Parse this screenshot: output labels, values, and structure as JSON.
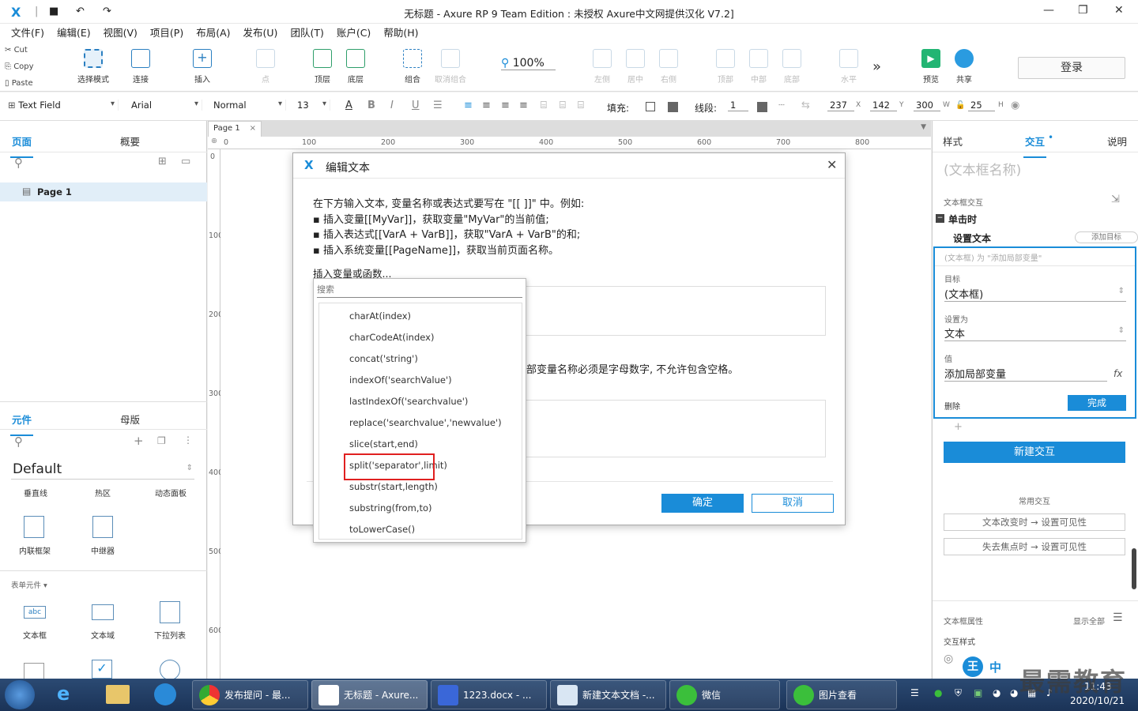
{
  "titlebar": {
    "logo": "X",
    "title": "无标题 - Axure RP 9 Team Edition : 未授权      Axure中文网提供汉化 V7.2]",
    "min": "—",
    "max": "❐",
    "close": "✕"
  },
  "menu": [
    "文件(F)",
    "编辑(E)",
    "视图(V)",
    "项目(P)",
    "布局(A)",
    "发布(U)",
    "团队(T)",
    "账户(C)",
    "帮助(H)"
  ],
  "clipboard": {
    "cut": "Cut",
    "copy": "Copy",
    "paste": "Paste"
  },
  "toolbar": {
    "select_mode": "选择模式",
    "connect": "连接",
    "insert": "插入",
    "point": "点",
    "top_layer": "顶层",
    "bottom_layer": "底层",
    "group": "组合",
    "ungroup": "取消组合",
    "zoom": "100%",
    "align_left": "左侧",
    "align_center": "居中",
    "align_right": "右侧",
    "align_top": "顶部",
    "align_middle": "中部",
    "align_bottom": "底部",
    "distribute_h": "水平",
    "more": "»",
    "preview": "预览",
    "share": "共享",
    "login": "登录"
  },
  "format": {
    "widget_type": "Text Field",
    "font": "Arial",
    "style": "Normal",
    "size": "13",
    "fill_label": "填充:",
    "line_label": "线段:",
    "line_width": "1",
    "x": "237",
    "x_label": "X",
    "y": "142",
    "y_label": "Y",
    "w": "300",
    "w_label": "W",
    "h": "25",
    "h_label": "H"
  },
  "left": {
    "tab_pages": "页面",
    "tab_outline": "概要",
    "page_item": "Page 1",
    "tab_widgets": "元件",
    "tab_masters": "母版",
    "library": "Default",
    "widgets_row1": [
      "垂直线",
      "热区",
      "动态面板"
    ],
    "widgets_row2": [
      "内联框架",
      "中继器"
    ],
    "form_section": "表单元件 ▾",
    "widgets_row3": [
      "文本框",
      "文本域",
      "下拉列表"
    ]
  },
  "canvas": {
    "page_tab": "Page 1",
    "ruler_h": [
      "0",
      "100",
      "200",
      "300",
      "400",
      "500",
      "600",
      "700",
      "800"
    ],
    "ruler_v": [
      "0",
      "100",
      "200",
      "300",
      "400",
      "500",
      "600"
    ]
  },
  "dialog": {
    "title": "编辑文本",
    "line1": "在下方输入文本, 变量名称或表达式要写在 \"[[ ]]\" 中。例如:",
    "line2": "▪ 插入变量[[MyVar]]，获取变量\"MyVar\"的当前值;",
    "line3": "▪ 插入表达式[[VarA + VarB]]，获取\"VarA + VarB\"的和;",
    "line4": "▪ 插入系统变量[[PageName]]，获取当前页面名称。",
    "insert_link": "插入变量或函数...",
    "hint": "部变量名称必须是字母数字, 不允许包含空格。",
    "ok": "确定",
    "cancel": "取消"
  },
  "dropdown": {
    "search_placeholder": "搜索",
    "functions": [
      "charAt(index)",
      "charCodeAt(index)",
      "concat('string')",
      "indexOf('searchValue')",
      "lastIndexOf('searchvalue')",
      "replace('searchvalue','newvalue')",
      "slice(start,end)",
      "split('separator',limit)",
      "substr(start,length)",
      "substring(from,to)",
      "toLowerCase()"
    ]
  },
  "right": {
    "tab_style": "样式",
    "tab_interact": "交互",
    "tab_notes": "说明",
    "widget_name": "(文本框名称)",
    "section": "文本框交互",
    "event": "单击时",
    "action": "设置文本",
    "add_target": "添加目标",
    "summary": "(文本框) 为 \"添加局部变量\"",
    "target_label": "目标",
    "target_value": "(文本框)",
    "setas_label": "设置为",
    "setas_value": "文本",
    "value_label": "值",
    "value_value": "添加局部变量",
    "fx": "fx",
    "delete": "删除",
    "done": "完成",
    "plus": "+",
    "new_interaction": "新建交互",
    "common": "常用交互",
    "common1": "文本改变时 → 设置可见性",
    "common2": "失去焦点时 → 设置可见性",
    "props": "文本框属性",
    "show_all": "显示全部",
    "interact_style": "交互样式"
  },
  "taskbar": {
    "tasks": [
      "发布提问 - 最...",
      "无标题 - Axure...",
      "1223.docx - ...",
      "新建文本文档 -...",
      "微信",
      "图片查看"
    ],
    "time": "11:43",
    "date": "2020/10/21",
    "ime": "中",
    "watermark": "最需教育"
  },
  "colors": {
    "accent": "#1a8cd8",
    "highlight": "#e02020",
    "taskbar": "#1b3357"
  }
}
